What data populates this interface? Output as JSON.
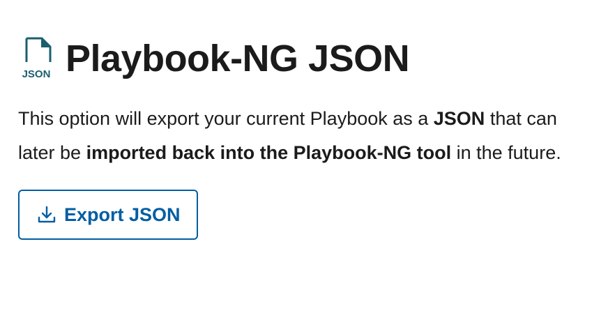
{
  "header": {
    "icon": "json-file-icon",
    "icon_label": "JSON",
    "title": "Playbook-NG JSON"
  },
  "description": {
    "part1": "This option will export your current Playbook as a ",
    "bold1": "JSON",
    "part2": " that can later be ",
    "bold2": "imported back into the Playbook-NG tool",
    "part3": " in the future."
  },
  "export_button": {
    "icon": "download-icon",
    "label": "Export JSON"
  },
  "colors": {
    "accent": "#005ea2",
    "icon_teal": "#1a5f6e",
    "text": "#1b1b1b"
  }
}
